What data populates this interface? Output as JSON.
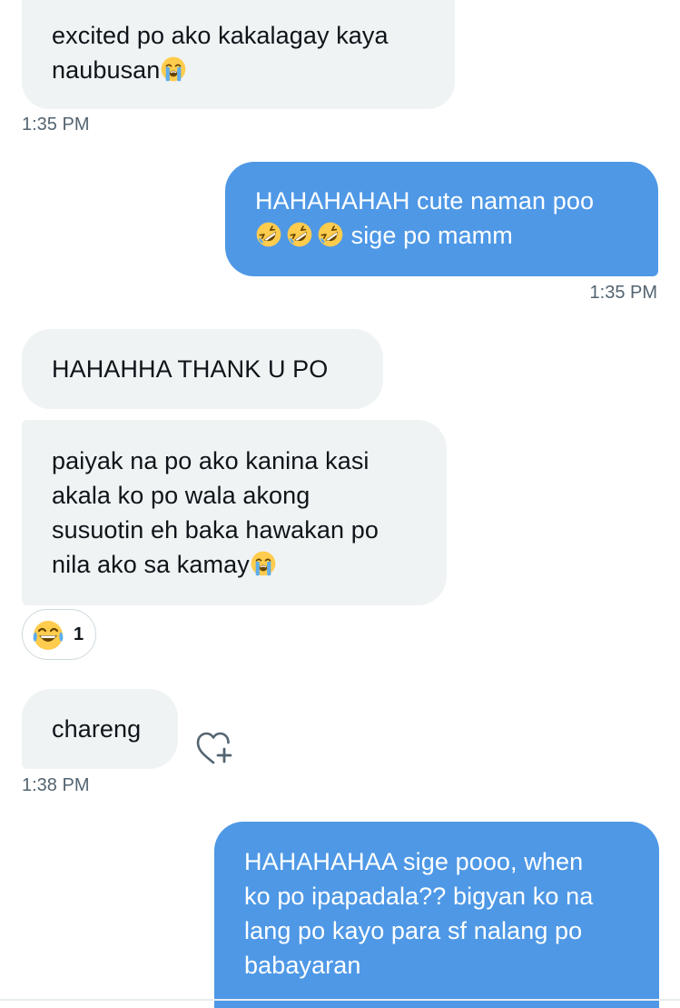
{
  "messages": [
    {
      "direction": "received",
      "lines": [
        "excited po ako kakalagay kaya",
        "naubusan"
      ],
      "trailing_emoji": "loudly-crying-face-emoji",
      "timestamp": "1:35 PM"
    },
    {
      "direction": "sent",
      "lines": [
        "HAHAHAHAH cute naman poo",
        "sige po mamm"
      ],
      "leading_emojis": [
        "rolling-on-floor-laughing-emoji",
        "rolling-on-floor-laughing-emoji",
        "rolling-on-floor-laughing-emoji"
      ],
      "timestamp": "1:35 PM"
    },
    {
      "direction": "received",
      "lines": [
        "HAHAHHA THANK U PO"
      ]
    },
    {
      "direction": "received",
      "lines": [
        "paiyak na po ako kanina kasi",
        "akala ko po wala akong",
        "susuotin eh baka hawakan po",
        "nila ako sa kamay"
      ],
      "trailing_emoji": "loudly-crying-face-emoji",
      "reaction": {
        "emoji": "face-with-tears-of-joy-emoji",
        "count": "1"
      }
    },
    {
      "direction": "received",
      "lines": [
        "chareng"
      ],
      "action_icon": "heart-plus-icon",
      "timestamp": "1:38 PM"
    },
    {
      "direction": "sent",
      "lines": [
        "HAHAHAHAA sige pooo, when",
        "ko po ipapadala?? bigyan ko na",
        "lang po kayo para sf nalang po",
        "babayaran"
      ]
    }
  ],
  "colors": {
    "sent_bubble": "#4e98e6",
    "received_bubble": "#eff3f4",
    "timestamp_text": "#536471",
    "reaction_border": "#cfd9de"
  }
}
